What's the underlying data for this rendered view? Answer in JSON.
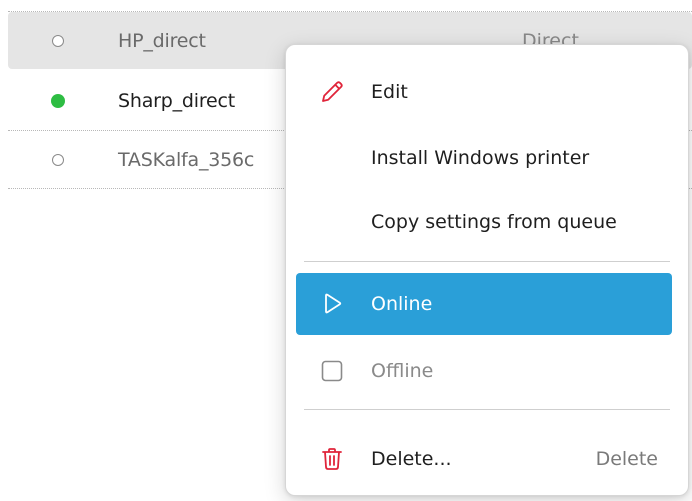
{
  "queues": [
    {
      "name": "HP_direct",
      "type": "Direct",
      "online": false,
      "selected": true
    },
    {
      "name": "Sharp_direct",
      "type": "",
      "online": true,
      "selected": false
    },
    {
      "name": "TASKalfa_356c",
      "type": "",
      "online": false,
      "selected": false
    }
  ],
  "colors": {
    "online_dot": "#2ebd43",
    "menu_highlight": "#2a9fd8",
    "delete_icon": "#e0243a",
    "edit_icon": "#e0243a"
  },
  "context_menu": {
    "edit": {
      "label": "Edit",
      "icon": "pencil-icon"
    },
    "install": {
      "label": "Install Windows printer"
    },
    "copy": {
      "label": "Copy settings from queue"
    },
    "online": {
      "label": "Online",
      "icon": "play-icon"
    },
    "offline": {
      "label": "Offline",
      "icon": "square-icon"
    },
    "delete": {
      "label": "Delete...",
      "shortcut": "Delete",
      "icon": "trash-icon"
    }
  }
}
